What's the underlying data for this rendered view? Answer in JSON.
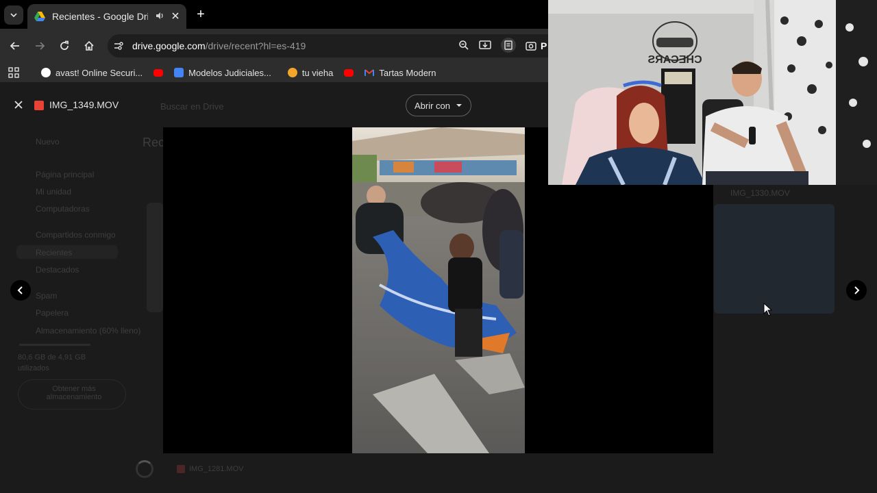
{
  "browser": {
    "tab": {
      "title": "Recientes - Google Drive",
      "audio_icon": "speaker-icon",
      "close_icon": "close-icon"
    },
    "new_tab_label": "+",
    "address": {
      "host": "drive.google.com",
      "path": "/drive/recent?hl=es-419"
    },
    "extension_truncated": "P",
    "bookmarks": [
      {
        "label": "avast! Online Securi...",
        "icon": "avast-icon",
        "color": "#ffffff"
      },
      {
        "label": "",
        "icon": "youtube-icon",
        "color": "#ff0000"
      },
      {
        "label": "Modelos Judiciales...",
        "icon": "docs-icon",
        "color": "#4285f4"
      },
      {
        "label": "tu vieha",
        "icon": "face-icon",
        "color": "#f4a52a"
      },
      {
        "label": "",
        "icon": "youtube-icon",
        "color": "#ff0000"
      },
      {
        "label": "Tartas Modern",
        "icon": "gmail-icon",
        "color": "#ea4335"
      }
    ]
  },
  "viewer": {
    "file_name": "IMG_1349.MOV",
    "open_with_label": "Abrir con",
    "bottom_file_name": "IMG_1281.MOV"
  },
  "drive_background": {
    "search_placeholder": "Buscar en Drive",
    "new_label": "Nuevo",
    "page_title": "Reci",
    "nav_items": [
      "Página principal",
      "Mi unidad",
      "Computadoras",
      "Compartidos conmigo",
      "Recientes",
      "Destacados",
      "Spam",
      "Papelera",
      "Almacenamiento (60% lleno)"
    ],
    "storage_text": "80,6 GB de 4,91 GB utilizados",
    "get_storage_label": "Obtener más almacenamiento",
    "right_file_name": "IMG_1330.MOV"
  },
  "colors": {
    "tab_bg": "#2d2d2d",
    "player_bg": "#000000",
    "accent_red": "#ea4335"
  }
}
